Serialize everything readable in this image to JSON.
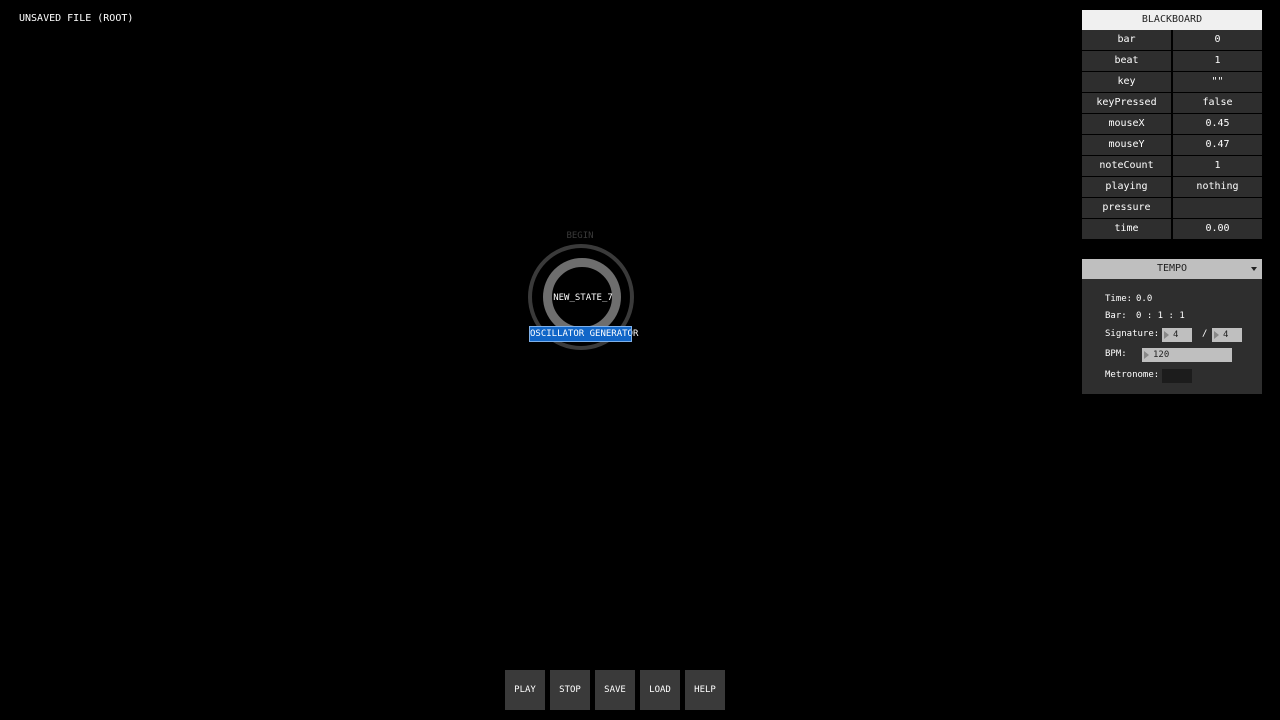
{
  "file_title": "UNSAVED FILE (ROOT)",
  "blackboard": {
    "title": "BLACKBOARD",
    "rows": [
      {
        "key": "bar",
        "value": "0"
      },
      {
        "key": "beat",
        "value": "1"
      },
      {
        "key": "key",
        "value": "\"\""
      },
      {
        "key": "keyPressed",
        "value": "false"
      },
      {
        "key": "mouseX",
        "value": "0.45"
      },
      {
        "key": "mouseY",
        "value": "0.47"
      },
      {
        "key": "noteCount",
        "value": "1"
      },
      {
        "key": "playing",
        "value": "nothing"
      },
      {
        "key": "pressure",
        "value": ""
      },
      {
        "key": "time",
        "value": "0.00"
      }
    ]
  },
  "tempo": {
    "title": "TEMPO",
    "time_label": "Time:",
    "time_value": "0.0",
    "bar_label": "Bar:",
    "bar_value": "0 : 1 : 1",
    "signature_label": "Signature:",
    "signature_numerator": "4",
    "signature_separator": "/",
    "signature_denominator": "4",
    "bpm_label": "BPM:",
    "bpm_value": "120",
    "metronome_label": "Metronome:"
  },
  "state_node": {
    "begin_label": "BEGIN",
    "name": "NEW_STATE_7",
    "generator": "OSCILLATOR GENERATOR"
  },
  "buttons": {
    "play": "PLAY",
    "stop": "STOP",
    "save": "SAVE",
    "load": "LOAD",
    "help": "HELP"
  }
}
